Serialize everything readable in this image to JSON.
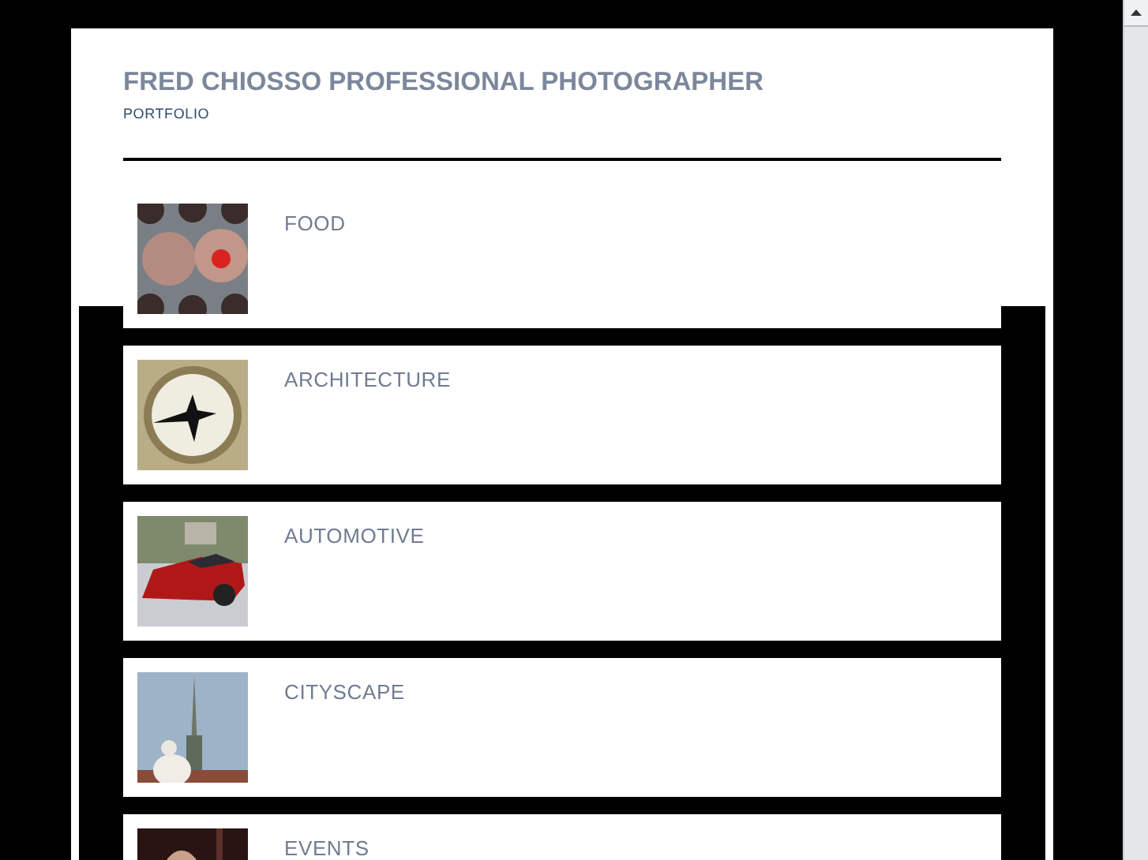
{
  "header": {
    "title": "FRED CHIOSSO PROFESSIONAL PHOTOGRAPHER",
    "subtitle": "PORTFOLIO"
  },
  "categories": [
    {
      "label": "FOOD"
    },
    {
      "label": "ARCHITECTURE"
    },
    {
      "label": "AUTOMOTIVE"
    },
    {
      "label": "CITYSCAPE"
    },
    {
      "label": "EVENTS"
    }
  ]
}
